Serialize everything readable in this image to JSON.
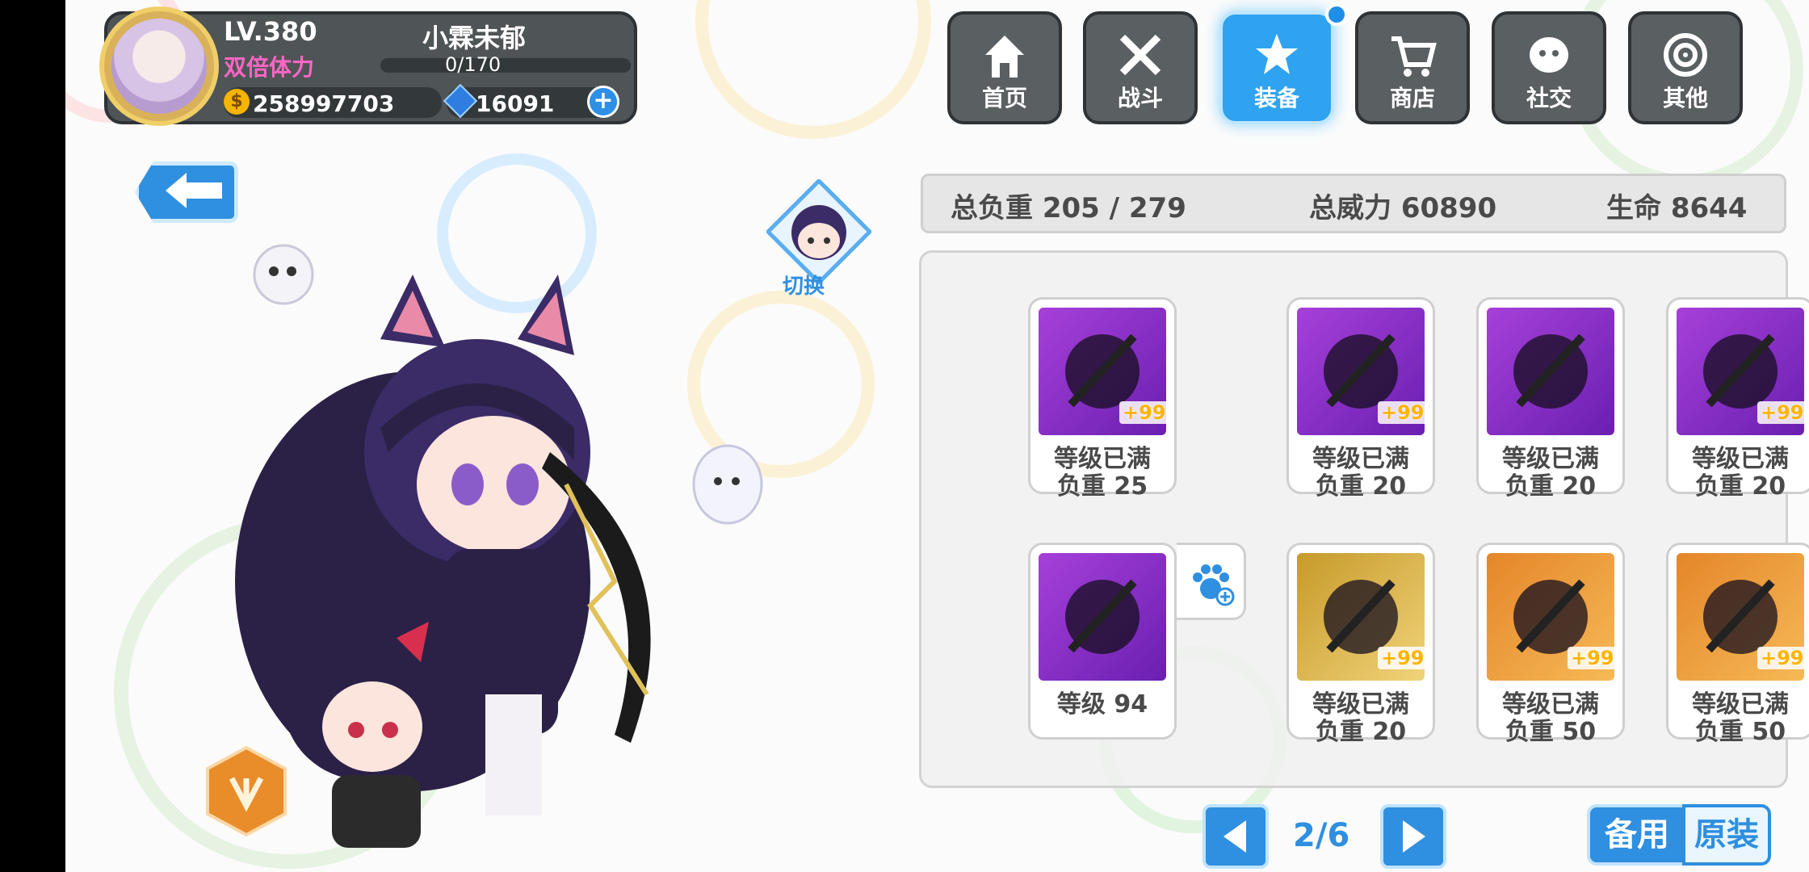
{
  "player": {
    "level": "LV.380",
    "name": "小霖未郁",
    "stamina_label": "双倍体力",
    "stamina_value": "0/170",
    "gold": "258997703",
    "gems": "16091",
    "add_icon": "plus-icon"
  },
  "nav": {
    "items": [
      {
        "label": "首页",
        "icon": "house-icon"
      },
      {
        "label": "战斗",
        "icon": "crossed-swords-icon"
      },
      {
        "label": "装备",
        "icon": "star-gun-icon"
      },
      {
        "label": "商店",
        "icon": "cart-icon"
      },
      {
        "label": "社交",
        "icon": "face-icon"
      },
      {
        "label": "其他",
        "icon": "target-icon"
      }
    ],
    "active_index": 2
  },
  "switch_label": "切换",
  "stats": {
    "load": "总负重 205 / 279",
    "power": "总威力 60890",
    "hp": "生命 8644"
  },
  "equipment": [
    {
      "level_text": "等级已满",
      "weight_text": "负重 25",
      "plus": "+99",
      "theme": "purple"
    },
    {
      "level_text": "等级已满",
      "weight_text": "负重 20",
      "plus": "+99",
      "theme": "purple"
    },
    {
      "level_text": "等级已满",
      "weight_text": "负重 20",
      "plus": "",
      "theme": "purple"
    },
    {
      "level_text": "等级已满",
      "weight_text": "负重 20",
      "plus": "+99",
      "theme": "purple"
    },
    {
      "level_text": "等级 94",
      "weight_text": "",
      "plus": "",
      "theme": "purple"
    },
    {
      "level_text": "等级已满",
      "weight_text": "负重 20",
      "plus": "+99",
      "theme": "gold"
    },
    {
      "level_text": "等级已满",
      "weight_text": "负重 50",
      "plus": "+99",
      "theme": "orange"
    },
    {
      "level_text": "等级已满",
      "weight_text": "负重 50",
      "plus": "+99",
      "theme": "orange"
    }
  ],
  "pager": {
    "text": "2/6"
  },
  "buttons": {
    "spare": "备用",
    "original": "原装"
  },
  "colors": {
    "accent": "#2f8fe0",
    "panel_dark": "#4f5457",
    "stamina": "#ff66c4",
    "plus": "#ffb400"
  }
}
